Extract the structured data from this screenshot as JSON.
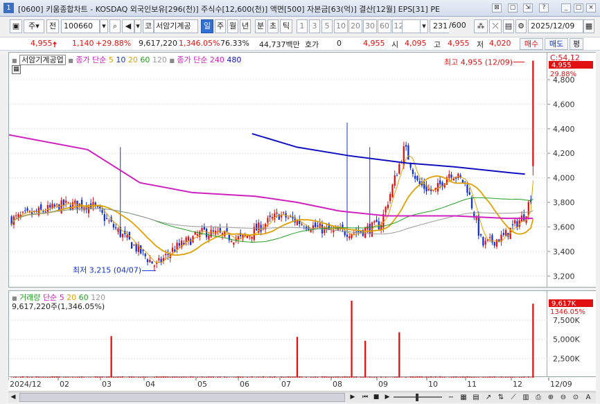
{
  "window": {
    "number": "1",
    "title": "[0600] 키움종합차트 - KOSDAQ 외국인보유[296(천)] 주식수[12,600(천)] 액면[500] 자본금[63(억)] 결산[12월] EPS[31] PE"
  },
  "toolbar": {
    "market": "주",
    "compare": "전",
    "code": "100660",
    "ko_btn": "코",
    "stock_name": "서암기계공",
    "periods": [
      "일",
      "주",
      "월",
      "년",
      "분",
      "초",
      "틱"
    ],
    "selected_period": "일",
    "intervals": [
      "1",
      "3",
      "5",
      "10",
      "20",
      "30",
      "60",
      "120"
    ],
    "count": "231",
    "count_max": "/600",
    "date": "2025/12/09"
  },
  "quote": {
    "price": "4,955",
    "change": "1,140",
    "change_pct": "+29.88%",
    "volume": "9,617,220",
    "volume_pct": "1,346.05%",
    "turnover": "76.33%",
    "amount": "44,737백만",
    "hoga_label": "호가",
    "hoga": "0",
    "last": "4,955",
    "open_label": "시",
    "open": "4,095",
    "high_label": "고",
    "high": "4,955",
    "low_label": "저",
    "low": "4,020",
    "buy_btn": "매수",
    "sell_btn": "매도",
    "eval_btn": "평"
  },
  "price_panel": {
    "stock_tab": "서암기계공업",
    "ma_legend_label": "종가 단순",
    "ma_periods": [
      {
        "label": "5",
        "color": "#e0a000"
      },
      {
        "label": "10",
        "color": "#1030d0"
      },
      {
        "label": "20",
        "color": "#e0a000"
      },
      {
        "label": "60",
        "color": "#20a020"
      },
      {
        "label": "120",
        "color": "#999999"
      }
    ],
    "ma_legend_label2": "종가 단순",
    "ma_periods2": [
      {
        "label": "240",
        "color": "#d020c0"
      },
      {
        "label": "480",
        "color": "#1010c0"
      }
    ],
    "high_note": "최고 4,955 (12/09)",
    "low_note": "최저 3,215 (04/07)",
    "last_price_tag": "4,955",
    "last_pct_tag": "29.88%",
    "scale_top": "C:54,12",
    "colors": {
      "up": "#e01010",
      "down": "#1030d0"
    }
  },
  "volume_panel": {
    "legend_label": "거래량",
    "ma_label": "단순",
    "ma_periods": [
      {
        "label": "5",
        "color": "#d020c0"
      },
      {
        "label": "20",
        "color": "#e0a000"
      },
      {
        "label": "60",
        "color": "#20a020"
      },
      {
        "label": "120",
        "color": "#999999"
      }
    ],
    "current": "9,617,220주(1,346.05%)",
    "tag_value": "9,617K",
    "tag_pct": "1346.05%"
  },
  "x_axis": {
    "labels": [
      "2024/12",
      "02",
      "03",
      "04",
      "05",
      "06",
      "07",
      "08",
      "09",
      "10",
      "11",
      "12",
      "12/09"
    ]
  },
  "chart_data": {
    "type": "candlestick",
    "price_axis": {
      "ticks": [
        3200,
        3400,
        3600,
        3800,
        4000,
        4200,
        4400,
        4600,
        4800
      ],
      "ylim": [
        3100,
        5020
      ]
    },
    "volume_axis": {
      "ticks": [
        "2,500K",
        "5,000K",
        "7,500K"
      ],
      "ylim_k": [
        0,
        10000
      ]
    },
    "series_ma": [
      {
        "name": "240",
        "color": "#d020c0",
        "points": [
          [
            0,
            4350
          ],
          [
            0.15,
            4230
          ],
          [
            0.25,
            3960
          ],
          [
            0.35,
            3880
          ],
          [
            0.47,
            3850
          ],
          [
            0.55,
            3800
          ],
          [
            0.63,
            3730
          ],
          [
            0.72,
            3690
          ],
          [
            0.85,
            3690
          ],
          [
            0.95,
            3670
          ],
          [
            1.0,
            3670
          ]
        ]
      },
      {
        "name": "480",
        "color": "#1010c0",
        "points": [
          [
            0.464,
            4360
          ],
          [
            0.55,
            4250
          ],
          [
            0.65,
            4180
          ],
          [
            0.76,
            4120
          ],
          [
            0.85,
            4090
          ],
          [
            0.96,
            4040
          ],
          [
            0.985,
            4030
          ]
        ]
      }
    ],
    "key_points": [
      {
        "label": "최고",
        "date": "12/09",
        "price": 4955
      },
      {
        "label": "최저",
        "date": "04/07",
        "price": 3215
      }
    ],
    "volume_spikes_k": [
      {
        "month": "03",
        "value": 5400
      },
      {
        "month": "08",
        "value": 5300
      },
      {
        "month": "09",
        "value": 10000
      },
      {
        "month": "09",
        "value": 5900
      },
      {
        "month": "10",
        "value": 4800
      },
      {
        "month": "12",
        "value": 9617
      }
    ]
  }
}
